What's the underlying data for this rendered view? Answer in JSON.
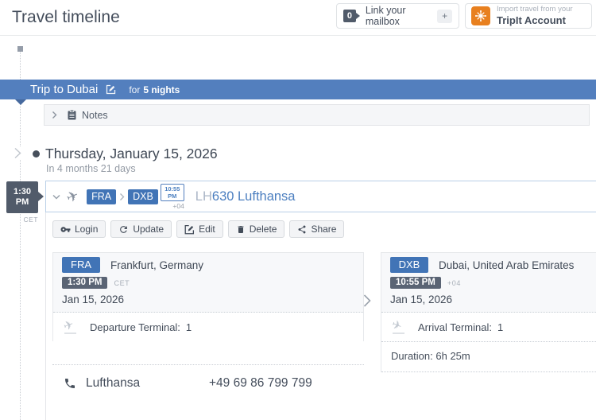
{
  "page": {
    "title": "Travel timeline"
  },
  "header": {
    "mailbox": {
      "count": "0",
      "label": "Link your mailbox",
      "add": "+"
    },
    "tripit": {
      "line1": "Import travel from your",
      "line2": "TripIt Account"
    }
  },
  "trip": {
    "title": "Trip to Dubai",
    "for_word": "for",
    "nights": "5 nights"
  },
  "notes": {
    "label": "Notes"
  },
  "day": {
    "date": "Thursday, January 15, 2026",
    "countdown": "In 4 months 21 days"
  },
  "flight": {
    "marker": {
      "time_line1": "1:30",
      "time_line2": "PM",
      "timezone": "CET"
    },
    "header": {
      "origin_code": "FRA",
      "dest_code": "DXB",
      "arrival_time_line1": "10:55",
      "arrival_time_line2": "PM",
      "arrival_offset": "+04",
      "airline_code": "LH",
      "flight_title": "630 Lufthansa"
    },
    "actions": [
      {
        "label": "Login",
        "icon": "key-icon"
      },
      {
        "label": "Update",
        "icon": "refresh-icon"
      },
      {
        "label": "Edit",
        "icon": "edit-icon"
      },
      {
        "label": "Delete",
        "icon": "trash-icon"
      },
      {
        "label": "Share",
        "icon": "share-icon"
      }
    ],
    "departure": {
      "airport_code": "FRA",
      "city": "Frankfurt, Germany",
      "time": "1:30 PM",
      "timezone": "CET",
      "date": "Jan 15, 2026",
      "terminal_label": "Departure Terminal:",
      "terminal_value": "1"
    },
    "arrival": {
      "airport_code": "DXB",
      "city": "Dubai, United Arab Emirates",
      "time": "10:55 PM",
      "timezone": "+04",
      "date": "Jan 15, 2026",
      "terminal_label": "Arrival Terminal:",
      "terminal_value": "1",
      "duration_label": "Duration:",
      "duration_value": "6h 25m"
    },
    "contact": {
      "airline": "Lufthansa",
      "phone": "+49 69 86 799 799"
    }
  },
  "icons": {
    "plane": "✈"
  },
  "colors": {
    "trip_bar_blue": "#537fbe",
    "badge_blue": "#4174b6",
    "link_blue": "#4c7fc0",
    "slate_badge": "#515b6a",
    "tripit_orange": "#e8801f",
    "time_badge_gray": "#5a6474"
  }
}
